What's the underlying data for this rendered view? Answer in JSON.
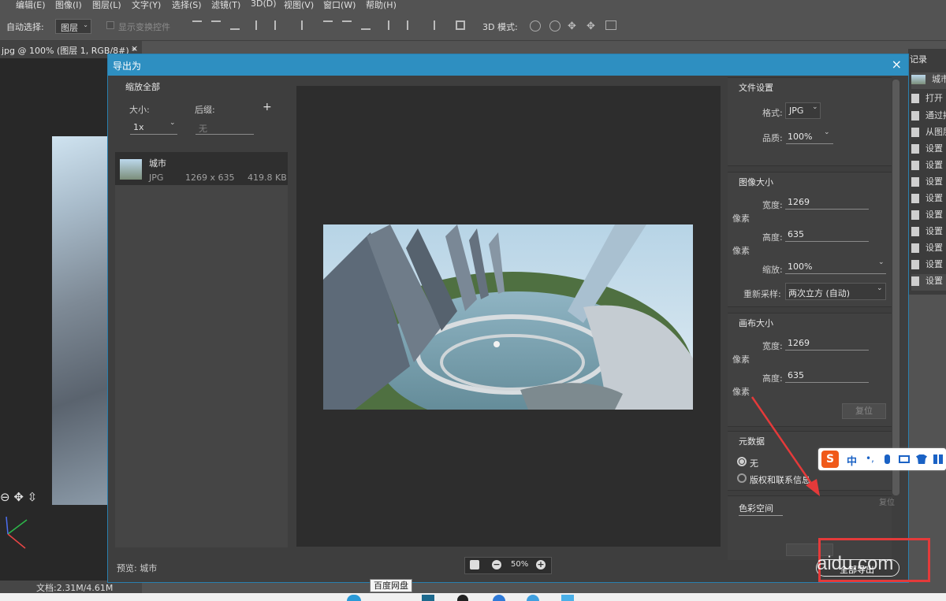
{
  "menubar": {
    "items": [
      "编辑(E)",
      "图像(I)",
      "图层(L)",
      "文字(Y)",
      "选择(S)",
      "滤镜(T)",
      "3D(D)",
      "视图(V)",
      "窗口(W)",
      "帮助(H)"
    ]
  },
  "options_bar": {
    "auto_select_label": "自动选择:",
    "auto_select_value": "图层",
    "show_transform_label": "显示变换控件",
    "mode_3d_label": "3D 模式:"
  },
  "document_tab": {
    "title": "jpg @ 100% (图层 1, RGB/8#) *",
    "close": "×"
  },
  "history_panel": {
    "title": "记录",
    "items": [
      "城市",
      "打开",
      "通过拷",
      "从图层",
      "设置",
      "设置",
      "设置",
      "设置",
      "设置",
      "设置",
      "设置",
      "设置",
      "设置"
    ]
  },
  "status_bar": {
    "doc_size": "文档:2.31M/4.61M"
  },
  "taskbar": {
    "tooltip": "百度网盘"
  },
  "dialog": {
    "title": "导出为",
    "close_icon": "×",
    "left": {
      "section_title": "缩放全部",
      "size_label": "大小:",
      "size_value": "1x",
      "suffix_label": "后缀:",
      "suffix_placeholder": "无",
      "add": "+",
      "asset": {
        "name": "城市",
        "format": "JPG",
        "dimensions": "1269 x 635",
        "file_size": "419.8 KB"
      },
      "preview_label": "预览: 城市"
    },
    "zoom": {
      "value": "50%",
      "minus": "−",
      "plus": "+"
    },
    "file_settings": {
      "title": "文件设置",
      "format_label": "格式:",
      "format_value": "JPG",
      "quality_label": "品质:",
      "quality_value": "100%"
    },
    "image_size": {
      "title": "图像大小",
      "width_label": "宽度:",
      "width_value": "1269",
      "height_label": "高度:",
      "height_value": "635",
      "unit": "像素",
      "scale_label": "缩放:",
      "scale_value": "100%",
      "resample_label": "重新采样:",
      "resample_value": "两次立方 (自动)"
    },
    "canvas_size": {
      "title": "画布大小",
      "width_label": "宽度:",
      "width_value": "1269",
      "height_label": "高度:",
      "height_value": "635",
      "unit": "像素",
      "reset_label": "复位"
    },
    "metadata": {
      "title": "元数据",
      "option_none": "无",
      "option_copyright": "版权和联系信息"
    },
    "color_space": {
      "title": "色彩空间"
    },
    "export_all_button": "全部导出",
    "reset_button": "复位"
  },
  "ime_toolbar": {
    "logo": "S",
    "lang": "中",
    "punct": "•,"
  },
  "watermark": "aidu.com",
  "colors": {
    "dialog_title_bg": "#2e8fc1",
    "annotation_red": "#e43a3a"
  }
}
